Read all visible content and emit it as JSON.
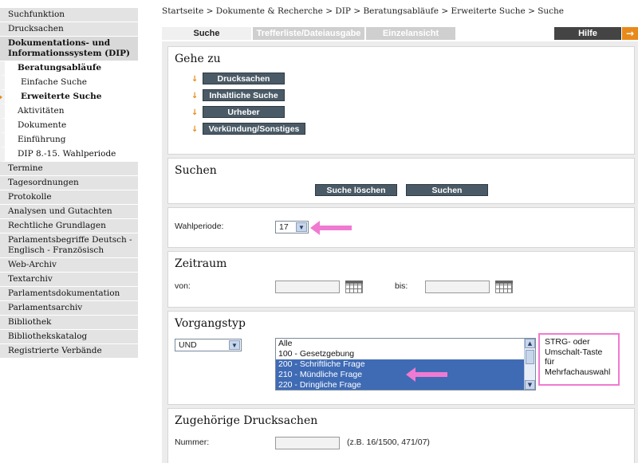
{
  "breadcrumb": "Startseite > Dokumente & Recherche > DIP > Beratungsabläufe > Erweiterte Suche > Suche",
  "sidebar": {
    "items": [
      {
        "label": "Suchfunktion",
        "kind": "top"
      },
      {
        "label": "Drucksachen",
        "kind": "top"
      },
      {
        "label": "Dokumentations- und Informationssystem (DIP)",
        "kind": "bold"
      },
      {
        "label": "Beratungsabläufe",
        "kind": "sub-bold"
      },
      {
        "label": "Einfache Suche",
        "kind": "sub2"
      },
      {
        "label": "Erweiterte Suche",
        "kind": "sub2-current"
      },
      {
        "label": "Aktivitäten",
        "kind": "sub"
      },
      {
        "label": "Dokumente",
        "kind": "sub"
      },
      {
        "label": "Einführung",
        "kind": "sub"
      },
      {
        "label": "DIP 8.-15. Wahlperiode",
        "kind": "sub"
      },
      {
        "label": "Termine",
        "kind": "top"
      },
      {
        "label": "Tagesordnungen",
        "kind": "top"
      },
      {
        "label": "Protokolle",
        "kind": "top"
      },
      {
        "label": "Analysen und Gutachten",
        "kind": "top"
      },
      {
        "label": "Rechtliche Grundlagen",
        "kind": "top"
      },
      {
        "label": "Parlamentsbegriffe Deutsch - Englisch - Französisch",
        "kind": "top"
      },
      {
        "label": "Web-Archiv",
        "kind": "top"
      },
      {
        "label": "Textarchiv",
        "kind": "top"
      },
      {
        "label": "Parlamentsdokumentation",
        "kind": "top"
      },
      {
        "label": "Parlamentsarchiv",
        "kind": "top"
      },
      {
        "label": "Bibliothek",
        "kind": "top"
      },
      {
        "label": "Bibliothekskatalog",
        "kind": "top"
      },
      {
        "label": "Registrierte Verbände",
        "kind": "top"
      }
    ]
  },
  "tabs": {
    "suche": "Suche",
    "trefferliste": "Trefferliste/Dateiausgabe",
    "einzelansicht": "Einzelansicht",
    "hilfe": "Hilfe"
  },
  "gehe_zu": {
    "title": "Gehe zu",
    "buttons": [
      "Drucksachen",
      "Inhaltliche Suche",
      "Urheber",
      "Verkündung/Sonstiges"
    ]
  },
  "suchen": {
    "title": "Suchen",
    "clear_label": "Suche löschen",
    "search_label": "Suchen"
  },
  "wahlperiode": {
    "label": "Wahlperiode:",
    "value": "17"
  },
  "zeitraum": {
    "title": "Zeitraum",
    "von_label": "von:",
    "bis_label": "bis:"
  },
  "vorgangstyp": {
    "title": "Vorgangstyp",
    "operator": "UND",
    "options": [
      {
        "label": "Alle",
        "selected": false
      },
      {
        "label": "100 - Gesetzgebung",
        "selected": false
      },
      {
        "label": "200 - Schriftliche Frage",
        "selected": true
      },
      {
        "label": "210 - Mündliche Frage",
        "selected": true
      },
      {
        "label": "220 - Dringliche Frage",
        "selected": true
      }
    ],
    "hint": "STRG- oder Umschalt-Taste für Mehrfachauswahl"
  },
  "drucksachen": {
    "title": "Zugehörige Drucksachen",
    "nummer_label": "Nummer:",
    "example": "(z.B. 16/1500, 471/07)"
  },
  "colors": {
    "accent_orange": "#e88a1a",
    "highlight_pink": "#f07ad2",
    "selection_blue": "#3f6bb5",
    "button_dark": "#4a5a66"
  }
}
